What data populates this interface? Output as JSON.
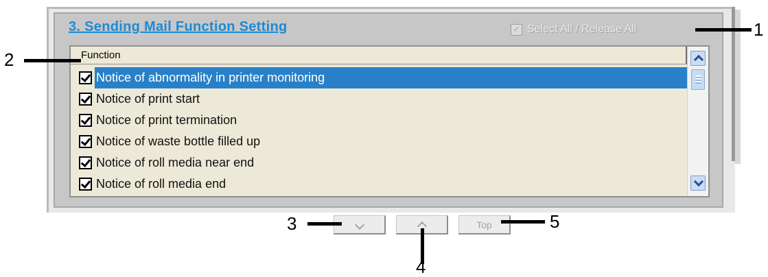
{
  "section": {
    "title": "3. Sending Mail Function Setting",
    "select_all_label": "Select All / Release All",
    "select_all_checked": true,
    "select_all_enabled": false
  },
  "list": {
    "header": "Function",
    "items": [
      {
        "label": "Notice of abnormality in printer monitoring",
        "checked": true,
        "selected": true
      },
      {
        "label": "Notice of print start",
        "checked": true,
        "selected": false
      },
      {
        "label": "Notice of print termination",
        "checked": true,
        "selected": false
      },
      {
        "label": "Notice of waste bottle filled up",
        "checked": true,
        "selected": false
      },
      {
        "label": "Notice of roll media near end",
        "checked": true,
        "selected": false
      },
      {
        "label": "Notice of roll media end",
        "checked": true,
        "selected": false
      }
    ]
  },
  "buttons": {
    "top_label": "Top"
  },
  "callouts": [
    "1",
    "2",
    "3",
    "4",
    "5"
  ],
  "colors": {
    "title": "#1b8ad8",
    "selection": "#2880c8",
    "section_bg": "#c7c7c7"
  }
}
